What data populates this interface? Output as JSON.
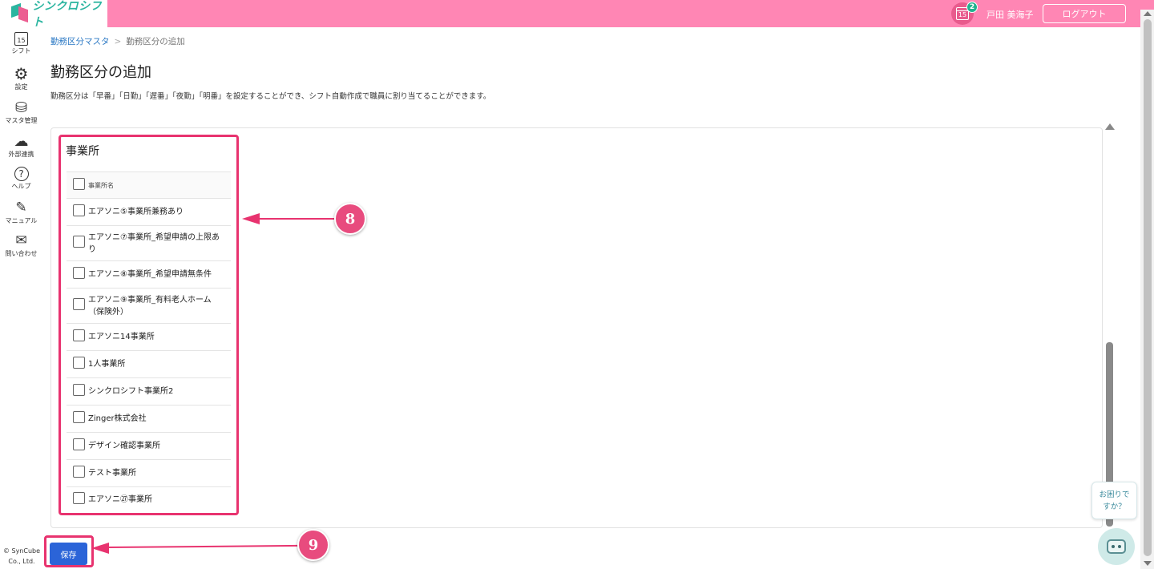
{
  "header": {
    "app_name": "シンクロシフト",
    "notification_icon": "calendar-icon",
    "calendar_day": "15",
    "notification_count": "2",
    "user_name": "戸田 美海子",
    "logout_label": "ログアウト",
    "accent_color": "#ff86b4"
  },
  "sidenav": {
    "items": [
      {
        "label": "シフト",
        "icon": "calendar-icon",
        "glyph": "15"
      },
      {
        "label": "設定",
        "icon": "gear-icon",
        "glyph": "⚙"
      },
      {
        "label": "マスタ管理",
        "icon": "database-icon",
        "glyph": "⛁"
      },
      {
        "label": "外部連携",
        "icon": "cloud-icon",
        "glyph": "☁"
      },
      {
        "label": "ヘルプ",
        "icon": "question-icon",
        "glyph": "?"
      },
      {
        "label": "マニュアル",
        "icon": "pencil-icon",
        "glyph": "✎"
      },
      {
        "label": "問い合わせ",
        "icon": "mail-icon",
        "glyph": "✉"
      }
    ],
    "copyright_line1": "© SynCube",
    "copyright_line2": "Co., Ltd."
  },
  "breadcrumb": {
    "link": "勤務区分マスタ",
    "separator": ">",
    "current": "勤務区分の追加"
  },
  "page": {
    "title": "勤務区分の追加",
    "description": "勤務区分は「早番」「日勤」「遅番」「夜勤」「明番」を設定することができ、シフト自動作成で職員に割り当てることができます。"
  },
  "office_section": {
    "title": "事業所",
    "column_header": "事業所名",
    "rows": [
      {
        "name": "エアソニ⑤事業所兼務あり",
        "checked": false
      },
      {
        "name": "エアソニ⑦事業所_希望申請の上限あり",
        "checked": false
      },
      {
        "name": "エアソニ⑧事業所_希望申請無条件",
        "checked": false
      },
      {
        "name": "エアソニ⑨事業所_有料老人ホーム（保険外）",
        "checked": false
      },
      {
        "name": "エアソニ14事業所",
        "checked": false
      },
      {
        "name": "1人事業所",
        "checked": false
      },
      {
        "name": "シンクロシフト事業所2",
        "checked": false
      },
      {
        "name": "Zinger株式会社",
        "checked": false
      },
      {
        "name": "デザイン確認事業所",
        "checked": false
      },
      {
        "name": "テスト事業所",
        "checked": false
      },
      {
        "name": "エアソニ㉗事業所",
        "checked": false
      }
    ]
  },
  "annotations": {
    "callout_office_list": "8",
    "callout_save": "9",
    "highlight_color": "#e8336f"
  },
  "save_label": "保存",
  "help_widget": {
    "line1": "お困りで",
    "line2": "すか？"
  }
}
